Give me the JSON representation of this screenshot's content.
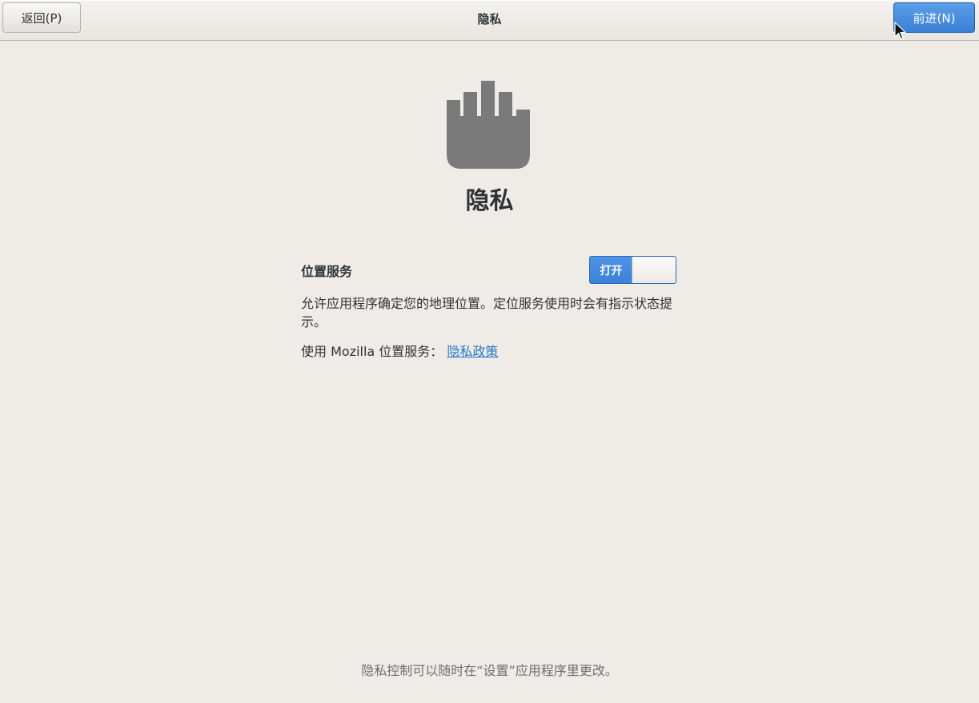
{
  "header": {
    "back_label": "返回(P)",
    "title": "隐私",
    "next_label": "前进(N)"
  },
  "main": {
    "icon": "hand-icon",
    "heading": "隐私",
    "location": {
      "label": "位置服务",
      "switch_state_label": "打开",
      "description": "允许应用程序确定您的地理位置。定位服务使用时会有指示状态提示。",
      "mozilla_text": "使用 Mozilla 位置服务：",
      "policy_link": "隐私政策"
    }
  },
  "footer": {
    "note": "隐私控制可以随时在“设置”应用程序里更改。"
  },
  "colors": {
    "accent": "#3b82d8",
    "link": "#2a76c6",
    "background": "#efebe7",
    "icon": "#7a7a7a"
  }
}
